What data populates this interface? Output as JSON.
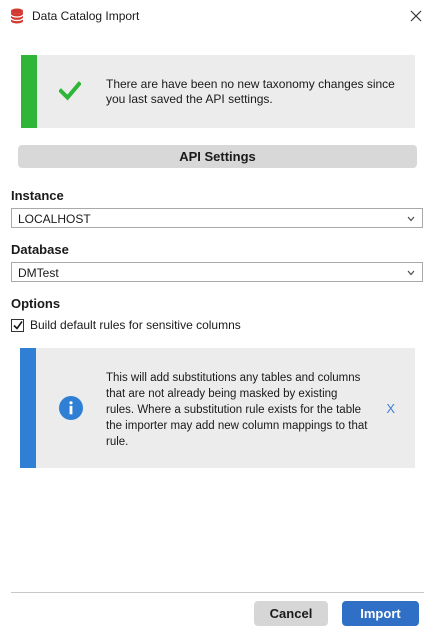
{
  "window": {
    "title": "Data Catalog Import"
  },
  "success_banner": {
    "message": "There are have been no new taxonomy changes since you last saved the API settings.",
    "accent_color": "#2fb537",
    "icon": "checkmark-icon"
  },
  "api_settings": {
    "header": "API Settings"
  },
  "instance": {
    "label": "Instance",
    "value": "LOCALHOST"
  },
  "database": {
    "label": "Database",
    "value": "DMTest"
  },
  "options": {
    "label": "Options",
    "build_default_rules": {
      "label": "Build default rules for sensitive columns",
      "checked": true
    }
  },
  "info_banner": {
    "message": "This will add substitutions any tables and columns that are not already being masked by existing rules. Where a substitution rule exists for the table the importer may add new column mappings to that rule.",
    "dismiss_label": "X",
    "accent_color": "#2f7fd4",
    "icon": "info-icon"
  },
  "footer": {
    "cancel_label": "Cancel",
    "import_label": "Import"
  }
}
